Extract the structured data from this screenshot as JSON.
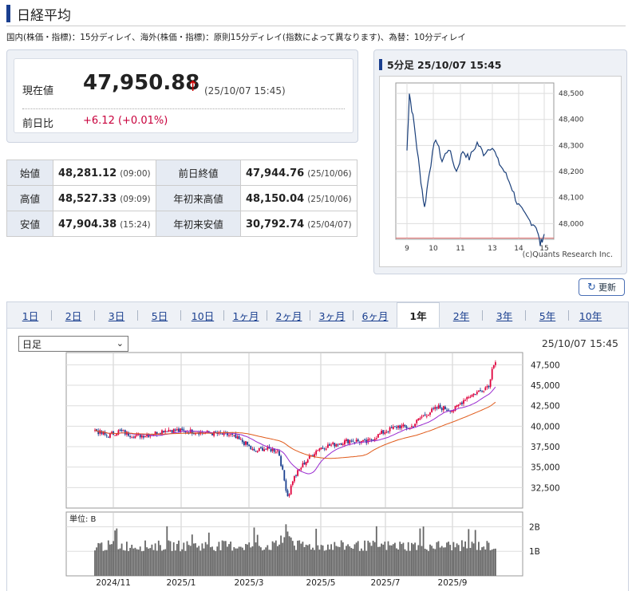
{
  "page": {
    "title": "日経平均",
    "delay_note": "国内(株価・指標)：15分ディレイ、海外(株価・指標)：原則15分ディレイ(指数によって異なります)、為替：10分ディレイ"
  },
  "current": {
    "label": "現在値",
    "value": "47,950.88",
    "arrow": "↑",
    "timestamp": "(25/10/07 15:45)",
    "change_label": "前日比",
    "change": "+6.12 (+0.01%)"
  },
  "stats": [
    {
      "l1": "始値",
      "v1": "48,281.12",
      "t1": "(09:00)",
      "l2": "前日終値",
      "v2": "47,944.76",
      "t2": "(25/10/06)"
    },
    {
      "l1": "高値",
      "v1": "48,527.33",
      "t1": "(09:09)",
      "l2": "年初来高値",
      "v2": "48,150.04",
      "t2": "(25/10/06)"
    },
    {
      "l1": "安値",
      "v1": "47,904.38",
      "t1": "(15:24)",
      "l2": "年初来安値",
      "v2": "30,792.74",
      "t2": "(25/04/07)"
    }
  ],
  "intraday": {
    "title": "5分足  25/10/07 15:45",
    "credit": "(c)Quants Research Inc.",
    "y_ticks": [
      "48,500",
      "48,400",
      "48,300",
      "48,200",
      "48,100",
      "48,000"
    ],
    "x_ticks": [
      "9",
      "10",
      "11",
      "13",
      "14",
      "15"
    ]
  },
  "refresh_label": "更新",
  "tabs": [
    "1日",
    "2日",
    "3日",
    "5日",
    "10日",
    "1ヶ月",
    "2ヶ月",
    "3ヶ月",
    "6ヶ月",
    "1年",
    "2年",
    "3年",
    "5年",
    "10年"
  ],
  "active_tab": "1年",
  "interval_select": "日足",
  "chart_time": "25/10/07 15:45",
  "price_y_ticks": [
    "47,500",
    "45,000",
    "42,500",
    "40,000",
    "37,500",
    "35,000",
    "32,500"
  ],
  "volume_unit": "単位: B",
  "volume_y_ticks": [
    "2B",
    "1B"
  ],
  "x_date_ticks": [
    "2024/11",
    "2025/1",
    "2025/3",
    "2025/5",
    "2025/7",
    "2025/9"
  ],
  "chart_data": [
    {
      "type": "line",
      "title": "",
      "x": [
        "9:00",
        "9:10",
        "9:30",
        "10:00",
        "10:30",
        "11:00",
        "11:30",
        "13:00",
        "13:30",
        "14:00",
        "14:30",
        "15:00",
        "15:24",
        "15:30"
      ],
      "series": [
        {
          "values": [
            48281,
            48500,
            48320,
            48060,
            48330,
            48270,
            48230,
            48310,
            48180,
            48090,
            48020,
            47990,
            47904,
            47950
          ]
        }
      ],
      "ylim": [
        47940,
        48540
      ],
      "grid": true
    },
    {
      "type": "line",
      "title": "",
      "x": [
        "2024/10",
        "2024/11",
        "2024/12",
        "2025/1",
        "2025/2",
        "2025/3",
        "2025/4",
        "2025/5",
        "2025/6",
        "2025/7",
        "2025/8",
        "2025/9",
        "2025/10"
      ],
      "series": [
        {
          "values": [
            39500,
            38800,
            39300,
            39600,
            39300,
            37000,
            31500,
            37800,
            38500,
            40500,
            42500,
            44500,
            47950
          ]
        }
      ],
      "ylim": [
        30792,
        48527
      ],
      "grid": true
    },
    {
      "type": "bar",
      "title": "",
      "ylabel": "単位: B",
      "categories": [
        "2024/11",
        "2025/1",
        "2025/3",
        "2025/5",
        "2025/7",
        "2025/9"
      ],
      "values": [
        1.1,
        1.2,
        1.1,
        1.3,
        1.2,
        1.4
      ],
      "ylim": [
        0,
        2.2
      ]
    }
  ]
}
